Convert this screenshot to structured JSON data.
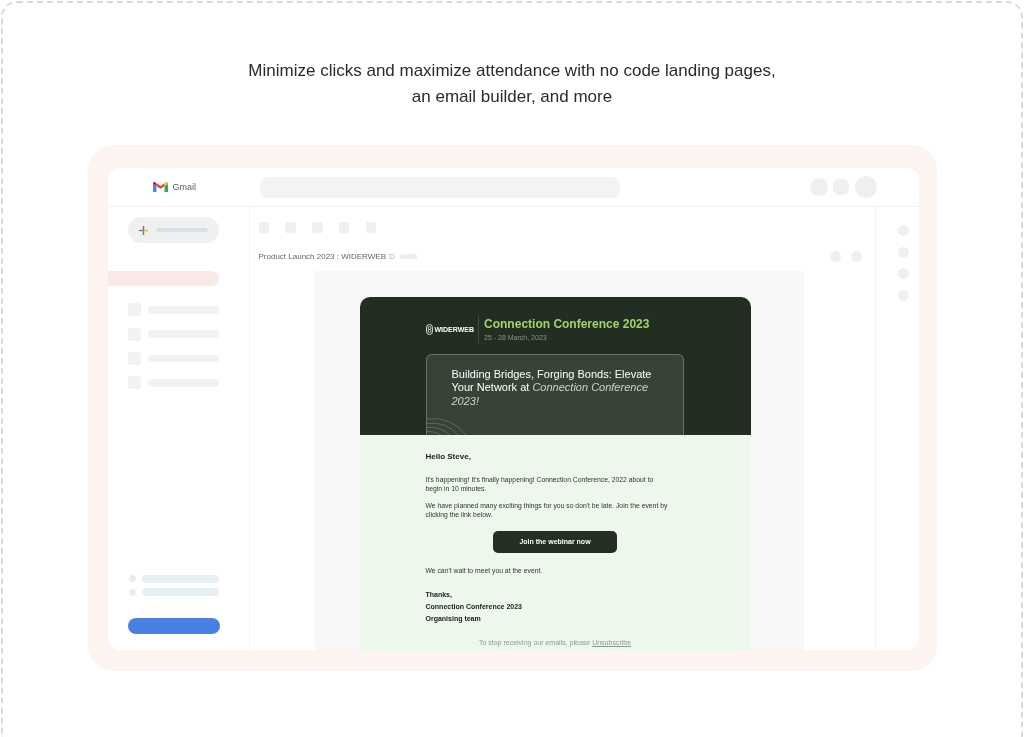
{
  "headline": "Minimize clicks and maximize attendance with no code landing pages,\nan email builder, and more",
  "mail_window": {
    "app_name": "Gmail",
    "sidebar": {
      "nav_items": [
        {
          "selected": true
        },
        {
          "selected": false
        },
        {
          "selected": false
        },
        {
          "selected": false
        },
        {
          "selected": false
        }
      ]
    },
    "subject": "Product Launch 2023 : WIDERWEB",
    "email": {
      "brand": "WIDERWEB",
      "title": "Connection Conference 2023",
      "dates": "25 - 28 March, 2023",
      "tagline": "Building Bridges, Forging Bonds: Elevate Your Network at *Connection Conference 2023!*",
      "greeting": "Hello Steve,",
      "paragraphs": [
        "It's happening! It's finally happening! Connection Conference, 2022 about to\nbegin in 10 minutes.",
        "We have planned many exciting things for you so don't be late. Join the event by\nclicking the link below."
      ],
      "cta": "Join the webinar now",
      "closing": "We can't wait to meet you at the event.",
      "signoff": [
        "Thanks,",
        "Connection Conference 2023",
        "Organising team"
      ],
      "footer": {
        "text": "To stop receiving our emails, please",
        "link": "Unsubscribe"
      }
    }
  }
}
